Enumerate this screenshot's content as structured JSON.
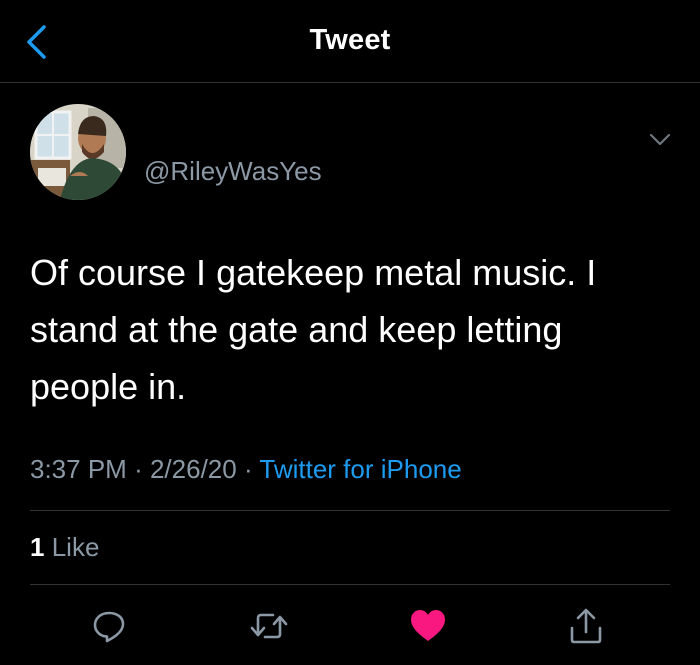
{
  "header": {
    "title": "Tweet",
    "back_icon": "chevron-left-icon"
  },
  "author": {
    "display_name": "",
    "handle": "@RileyWasYes",
    "avatar_icon": "avatar"
  },
  "tweet": {
    "text": "Of course I gatekeep metal music. I stand at the gate and keep letting people in.",
    "time": "3:37 PM",
    "date": "2/26/20",
    "separator": "·",
    "source": "Twitter for iPhone"
  },
  "stats": {
    "likes_count": "1",
    "likes_label": "Like"
  },
  "actions": [
    {
      "icon": "reply-icon"
    },
    {
      "icon": "retweet-icon"
    },
    {
      "icon": "heart-icon",
      "liked": true
    },
    {
      "icon": "share-icon"
    }
  ],
  "colors": {
    "background": "#000000",
    "accent": "#1d9bf0",
    "secondary_text": "#8b98a5",
    "divider": "#2f3336",
    "like": "#f91880"
  }
}
